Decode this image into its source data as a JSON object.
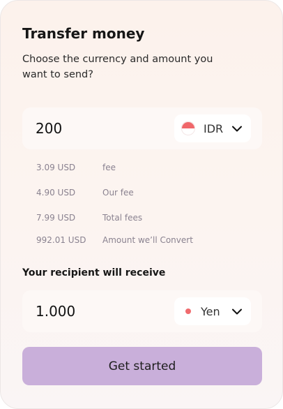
{
  "header": {
    "title": "Transfer money",
    "subtitle": "Choose the currency and amount you want to send?"
  },
  "send": {
    "amount": "200",
    "currency": "IDR",
    "flag_icon": "indonesia-flag-icon"
  },
  "fees": [
    {
      "amount": "3.09 USD",
      "label": "fee"
    },
    {
      "amount": "4.90 USD",
      "label": "Our fee"
    },
    {
      "amount": "7.99 USD",
      "label": "Total fees"
    },
    {
      "amount": "992.01 USD",
      "label": "Amount we’ll Convert"
    }
  ],
  "receive": {
    "label": "Your recipient will receive",
    "amount": "1.000",
    "currency": "Yen"
  },
  "cta": {
    "label": "Get started"
  },
  "colors": {
    "accent_button": "#c9afda",
    "flag_red": "#f0676a"
  }
}
